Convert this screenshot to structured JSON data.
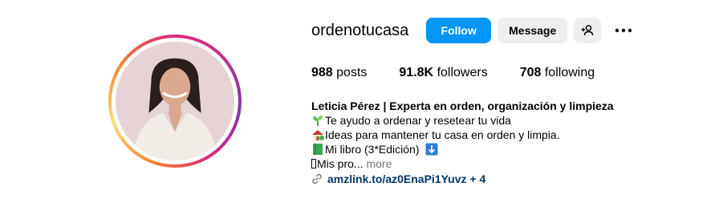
{
  "profile": {
    "username": "ordenotucasa",
    "avatar_alt": "avatar"
  },
  "actions": {
    "follow_label": "Follow",
    "message_label": "Message"
  },
  "stats": {
    "posts_count": "988",
    "posts_label": "posts",
    "followers_count": "91.8K",
    "followers_label": "followers",
    "following_count": "708",
    "following_label": "following"
  },
  "bio": {
    "name": "Leticia Pérez | Experta en orden, organización y limpieza",
    "line1": "Te ayudo a ordenar y resetear tu vida",
    "line2": "Ideas para mantener tu casa en orden y limpia.",
    "line3": "Mi libro (3*Edición)",
    "line4": "Mis pro...",
    "more": "more",
    "link": "amzlink.to/az0EnaPi1Yuvz + 4"
  },
  "colors": {
    "follow_blue": "#0095f6",
    "link_color": "#00376b",
    "muted": "#737373"
  }
}
